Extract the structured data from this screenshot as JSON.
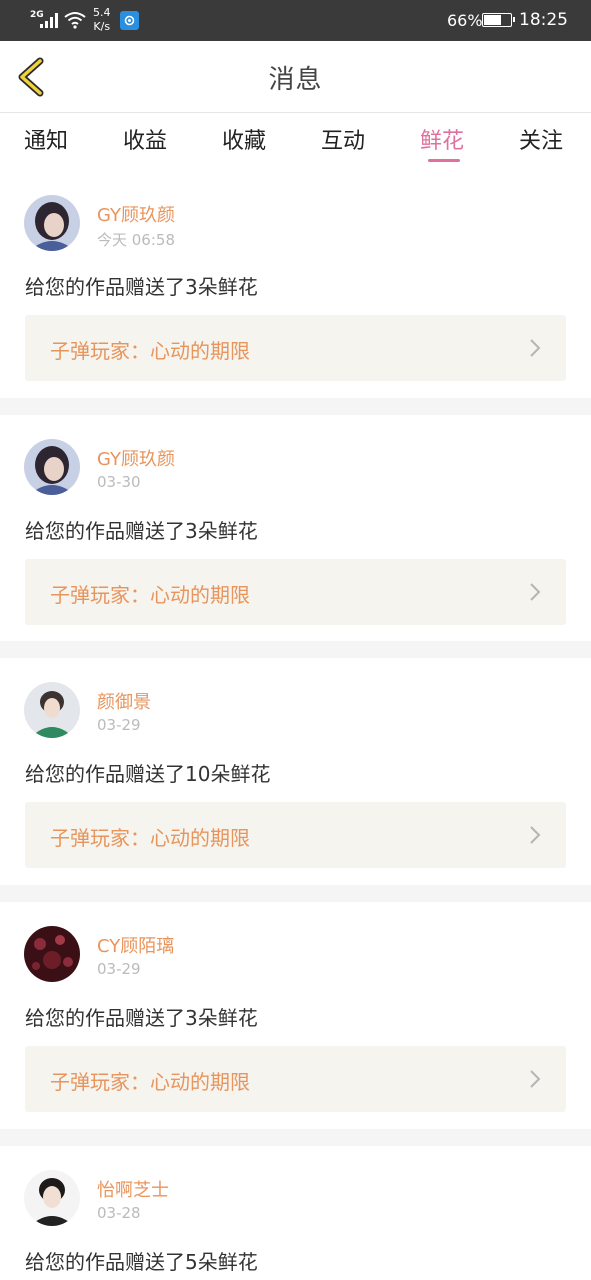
{
  "status_bar": {
    "network": "2G",
    "speed_value": "5.4",
    "speed_unit": "K/s",
    "battery_percent": "66%",
    "time": "18:25"
  },
  "nav": {
    "title": "消息",
    "back_icon": "chevron-left-icon",
    "back_color": "#f0d33c"
  },
  "tabs": [
    {
      "label": "通知",
      "active": false
    },
    {
      "label": "收益",
      "active": false
    },
    {
      "label": "收藏",
      "active": false
    },
    {
      "label": "互动",
      "active": false
    },
    {
      "label": "鲜花",
      "active": true
    },
    {
      "label": "关注",
      "active": false
    }
  ],
  "colors": {
    "accent": "#e0709e",
    "username": "#e8955d",
    "work_bg": "#f5f4ee"
  },
  "messages": [
    {
      "username": "GY顾玖颜",
      "time": "今天 06:58",
      "text": "给您的作品赠送了3朵鲜花",
      "work_title": "子弹玩家：心动的期限"
    },
    {
      "username": "GY顾玖颜",
      "time": "03-30",
      "text": "给您的作品赠送了3朵鲜花",
      "work_title": "子弹玩家：心动的期限"
    },
    {
      "username": "颜御景",
      "time": "03-29",
      "text": "给您的作品赠送了10朵鲜花",
      "work_title": "子弹玩家：心动的期限"
    },
    {
      "username": "CY顾陌璃",
      "time": "03-29",
      "text": "给您的作品赠送了3朵鲜花",
      "work_title": "子弹玩家：心动的期限"
    },
    {
      "username": "怡啊芝士",
      "time": "03-28",
      "text": "给您的作品赠送了5朵鲜花",
      "work_title": ""
    }
  ]
}
